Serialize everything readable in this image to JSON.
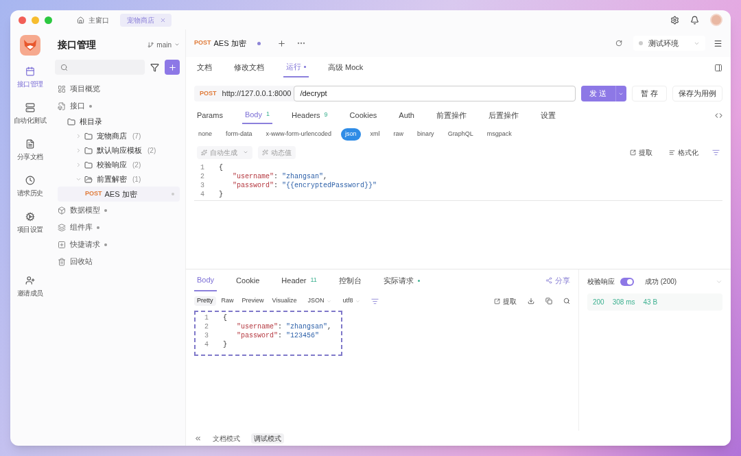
{
  "window_tabs": [
    {
      "label": "主窗口",
      "selected": false,
      "closable": false
    },
    {
      "label": "宠物商店",
      "selected": true,
      "closable": true
    }
  ],
  "rail": [
    {
      "label": "接口管理",
      "selected": true
    },
    {
      "label": "自动化测试",
      "selected": false
    },
    {
      "label": "分享文档",
      "selected": false
    },
    {
      "label": "请求历史",
      "selected": false
    },
    {
      "label": "项目设置",
      "selected": false
    },
    {
      "label": "邀请成员",
      "selected": false
    }
  ],
  "sidebar": {
    "title": "接口管理",
    "branch": "main",
    "nav": [
      {
        "kind": "section",
        "label": "项目概览",
        "dot": false
      },
      {
        "kind": "section",
        "label": "接口",
        "dot": true,
        "children": [
          {
            "kind": "folder",
            "label": "根目录",
            "children": [
              {
                "kind": "folder",
                "label": "宠物商店",
                "count": "(7)",
                "expanded": false
              },
              {
                "kind": "folder",
                "label": "默认响应模板",
                "count": "(2)",
                "expanded": false
              },
              {
                "kind": "folder",
                "label": "校验响应",
                "count": "(2)",
                "expanded": false
              },
              {
                "kind": "folder",
                "label": "前置解密",
                "count": "(1)",
                "expanded": true,
                "children": [
                  {
                    "kind": "request",
                    "method": "POST",
                    "label": "AES 加密",
                    "selected": true
                  }
                ]
              }
            ]
          }
        ]
      },
      {
        "kind": "section",
        "label": "数据模型",
        "dot": true
      },
      {
        "kind": "section",
        "label": "组件库",
        "dot": true
      },
      {
        "kind": "section",
        "label": "快捷请求",
        "dot": true
      },
      {
        "kind": "section",
        "label": "回收站",
        "dot": false
      }
    ]
  },
  "request_tab": {
    "method": "POST",
    "name": "AES 加密",
    "unsaved": true
  },
  "environment": "测试环境",
  "view_tabs": [
    {
      "label": "文档",
      "selected": false,
      "dot": false
    },
    {
      "label": "修改文档",
      "selected": false,
      "dot": false
    },
    {
      "label": "运行",
      "selected": true,
      "dot": true
    },
    {
      "label": "高级 Mock",
      "selected": false,
      "dot": false
    }
  ],
  "url": {
    "method": "POST",
    "base": "http://127.0.0.1:8000",
    "path": "/decrypt"
  },
  "actions": {
    "send": "发 送",
    "save": "暂 存",
    "save_case": "保存为用例"
  },
  "param_tabs": [
    {
      "label": "Params",
      "selected": false
    },
    {
      "label": "Body",
      "count": "1",
      "selected": true
    },
    {
      "label": "Headers",
      "count": "9",
      "selected": false
    },
    {
      "label": "Cookies",
      "selected": false
    },
    {
      "label": "Auth",
      "selected": false
    },
    {
      "label": "前置操作",
      "selected": false
    },
    {
      "label": "后置操作",
      "selected": false
    },
    {
      "label": "设置",
      "selected": false
    }
  ],
  "body_types": [
    {
      "label": "none",
      "selected": false
    },
    {
      "label": "form-data",
      "selected": false
    },
    {
      "label": "x-www-form-urlencoded",
      "selected": false
    },
    {
      "label": "json",
      "selected": true
    },
    {
      "label": "xml",
      "selected": false
    },
    {
      "label": "raw",
      "selected": false
    },
    {
      "label": "binary",
      "selected": false
    },
    {
      "label": "GraphQL",
      "selected": false
    },
    {
      "label": "msgpack",
      "selected": false
    }
  ],
  "body_tools": {
    "auto": "自动生成",
    "dynamic": "动态值",
    "extract": "提取",
    "format": "格式化"
  },
  "request_body": [
    {
      "number": "1",
      "parts": [
        {
          "kind": "punct",
          "text": "{"
        }
      ]
    },
    {
      "number": "2",
      "parts": [
        {
          "kind": "key",
          "text": "\"username\""
        },
        {
          "kind": "punct",
          "text": ": "
        },
        {
          "kind": "string",
          "text": "\"zhangsan\""
        },
        {
          "kind": "punct",
          "text": ","
        }
      ]
    },
    {
      "number": "3",
      "parts": [
        {
          "kind": "key",
          "text": "\"password\""
        },
        {
          "kind": "punct",
          "text": ": "
        },
        {
          "kind": "string",
          "text": "\"{{encryptedPassword}}\""
        }
      ]
    },
    {
      "number": "4",
      "parts": [
        {
          "kind": "punct",
          "text": "}"
        }
      ]
    }
  ],
  "response_tabs": [
    {
      "label": "Body",
      "selected": true,
      "dot": false
    },
    {
      "label": "Cookie",
      "selected": false,
      "dot": false
    },
    {
      "label": "Header",
      "count": "11",
      "selected": false,
      "dot": false
    },
    {
      "label": "控制台",
      "selected": false,
      "dot": false
    },
    {
      "label": "实际请求",
      "selected": false,
      "dot": true
    }
  ],
  "share": "分享",
  "response_views": [
    {
      "label": "Pretty",
      "selected": true
    },
    {
      "label": "Raw",
      "selected": false
    },
    {
      "label": "Preview",
      "selected": false
    },
    {
      "label": "Visualize",
      "selected": false
    }
  ],
  "response_format": "JSON",
  "response_encoding": "utf8",
  "response_extract": "提取",
  "response_body": [
    {
      "number": "1",
      "parts": [
        {
          "kind": "punct",
          "text": "{"
        }
      ]
    },
    {
      "number": "2",
      "parts": [
        {
          "kind": "key",
          "text": "\"username\""
        },
        {
          "kind": "punct",
          "text": ": "
        },
        {
          "kind": "string",
          "text": "\"zhangsan\""
        },
        {
          "kind": "punct",
          "text": ","
        }
      ]
    },
    {
      "number": "3",
      "parts": [
        {
          "kind": "key",
          "text": "\"password\""
        },
        {
          "kind": "punct",
          "text": ": "
        },
        {
          "kind": "string",
          "text": "\"123456\""
        }
      ]
    },
    {
      "number": "4",
      "parts": [
        {
          "kind": "punct",
          "text": "}"
        }
      ]
    }
  ],
  "validation": {
    "label": "校验响应",
    "on": true,
    "result": "成功 (200)",
    "status": "200",
    "time": "308 ms",
    "size": "43 B"
  },
  "bottom_modes": [
    {
      "label": "文档模式",
      "selected": false
    },
    {
      "label": "调试模式",
      "selected": true
    }
  ]
}
